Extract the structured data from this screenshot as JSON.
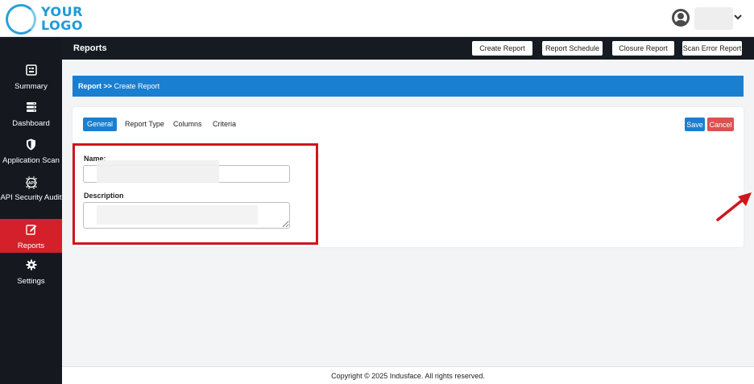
{
  "header": {
    "logo_line1": "YOUR",
    "logo_line2": "LOGO",
    "user_chevron": "⌄"
  },
  "sidebar": {
    "items": [
      {
        "label": "Summary",
        "icon": "summary-icon"
      },
      {
        "label": "Dashboard",
        "icon": "dashboard-icon"
      },
      {
        "label": "Application Scan",
        "icon": "shield-icon"
      },
      {
        "label": "API Security Audit",
        "icon": "api-chip-icon"
      },
      {
        "label": "Reports",
        "icon": "edit-icon",
        "active": true
      },
      {
        "label": "Settings",
        "icon": "gear-icon"
      }
    ]
  },
  "titlebar": {
    "title": "Reports",
    "buttons": [
      "Create Report",
      "Report Schedule",
      "Closure Report",
      "Scan Error Report"
    ]
  },
  "breadcrumb": {
    "root": "Report",
    "separator": ">>",
    "current": "Create Report"
  },
  "form": {
    "tabs": [
      "General",
      "Report Type",
      "Columns",
      "Criteria"
    ],
    "active_tab": "General",
    "save_label": "Save",
    "cancel_label": "Cancel",
    "name_label": "Name:",
    "description_label": "Description",
    "name_value": "",
    "description_value": ""
  },
  "footer": {
    "copyright": "Copyright © 2025 Indusface. All rights reserved."
  },
  "colors": {
    "sidebar_bg": "#15191f",
    "active_red": "#d3202a",
    "primary_blue": "#1a7fd0",
    "cancel_red": "#d9534f",
    "highlight_red": "#d0151c"
  }
}
